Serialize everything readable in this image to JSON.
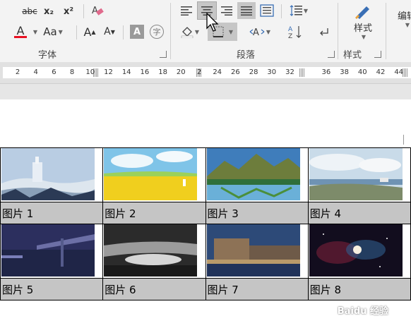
{
  "ribbon": {
    "font_group": {
      "label": "字体",
      "strikethrough": "abc",
      "subscript": "x₂",
      "superscript": "x²",
      "font_color_letter": "A",
      "font_color_bar": "#e81123",
      "change_case": "Aa",
      "grow_font": "A",
      "shrink_font": "A",
      "char_shading": "A",
      "enclosed_char": "字"
    },
    "paragraph_group": {
      "label": "段落"
    },
    "styles_group": {
      "label": "样式",
      "button_label": "样式"
    },
    "editing_group": {
      "button_label": "编辑"
    }
  },
  "ruler": {
    "ticks": [
      "2",
      "4",
      "6",
      "8",
      "10",
      "12",
      "14",
      "16",
      "18",
      "20",
      "2",
      "24",
      "26",
      "28",
      "30",
      "32",
      "",
      "36",
      "38",
      "40",
      "42",
      "44"
    ]
  },
  "table": {
    "rows": [
      {
        "captions": [
          "图片 1",
          "图片 2",
          "图片 3",
          "图片 4"
        ]
      },
      {
        "captions": [
          "图片 5",
          "图片 6",
          "图片 7",
          "图片 8"
        ]
      }
    ]
  },
  "watermark": "Baidu 经验"
}
